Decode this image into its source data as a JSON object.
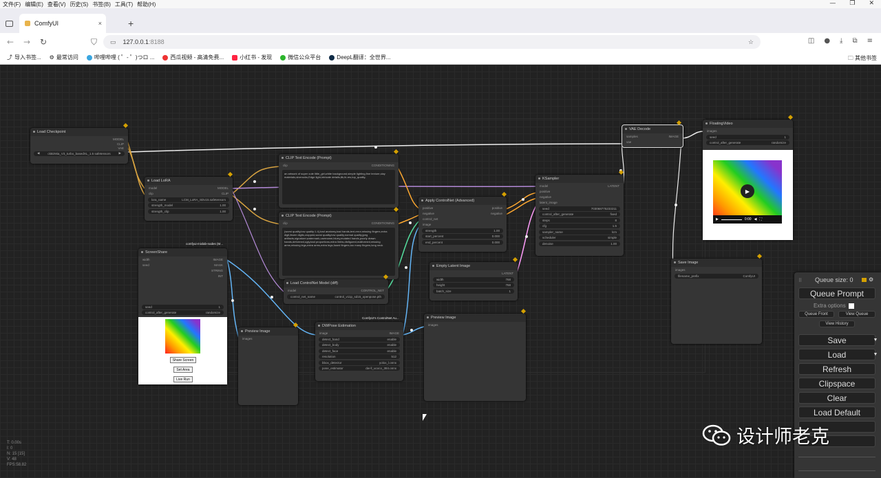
{
  "menubar": {
    "items": [
      "文件(F)",
      "编辑(E)",
      "查看(V)",
      "历史(S)",
      "书签(B)",
      "工具(T)",
      "帮助(H)"
    ]
  },
  "window_controls": {
    "minimize": "—",
    "restore": "❐",
    "close": "✕"
  },
  "tab": {
    "title": "ComfyUI",
    "close": "×",
    "new": "+"
  },
  "address": {
    "host": "127.0.0.1",
    "port": ":8188"
  },
  "bookmarks": {
    "items": [
      "导入书签...",
      "最常访问",
      "哔哩哔哩 ( ゜- ゜)つロ ...",
      "西瓜视频 - 高清免费...",
      "小红书 - 发现",
      "微信公众平台",
      "DeepL翻译：全世界..."
    ],
    "other": "其他书签"
  },
  "nodes": {
    "load_checkpoint": {
      "title": "Load Checkpoint",
      "outputs": [
        "MODEL",
        "CLIP",
        "VAE"
      ],
      "ckpt": "ckBzMia_V3_turbo_basedXL_1.5 safetensors"
    },
    "load_lora": {
      "title": "Load LoRA",
      "inputs": [
        "model",
        "clip"
      ],
      "outputs": [
        "MODEL",
        "CLIP"
      ],
      "widgets": [
        [
          "lora_name",
          "LCM_LoRA_SDv15.safetensors"
        ],
        [
          "strength_model",
          "1.00"
        ],
        [
          "strength_clip",
          "1.00"
        ]
      ]
    },
    "clip_pos": {
      "title": "CLIP Text Encode (Prompt)",
      "input": "clip",
      "output": "CONDITIONING",
      "text": "an artwork of super cute little_girl,white background,simple lighting,fine texture,clay materials,siverocks,Edge light,intricate details,8k,hi-res,top_quality,"
    },
    "clip_neg": {
      "title": "CLIP Text Encode (Prompt)",
      "input": "clip",
      "output": "CONDITIONING",
      "text": "(worst quality,low quality:1.4),bad anatomy,bad hands,text,error,missing fingers,extra digit,fewer digits,cropped,worst quality,low quality,normal quality,jpeg artifacts,signature,watermark,username,blurry,mutated hands,poorly drawn hands,deformed,ugly,bad proportions,extra limbs,disfigured,malformed,missing arms,missing legs,extra arms,extra legs,fused fingers,too many fingers,long neck"
    },
    "apply_controlnet": {
      "title": "Apply ControlNet (Advanced)",
      "inputs": [
        "positive",
        "negative",
        "control_net",
        "image"
      ],
      "outputs": [
        "positive",
        "negative"
      ],
      "widgets": [
        [
          "strength",
          "1.00"
        ],
        [
          "start_percent",
          "0.000"
        ],
        [
          "end_percent",
          "0.000"
        ]
      ]
    },
    "ksampler": {
      "title": "KSampler",
      "inputs": [
        "model",
        "positive",
        "negative",
        "latent_image"
      ],
      "output": "LATENT",
      "widgets": [
        [
          "seed",
          "703068775233211"
        ],
        [
          "control_after_generate",
          "fixed"
        ],
        [
          "steps",
          "8"
        ],
        [
          "cfg",
          "1.5"
        ],
        [
          "sampler_name",
          "lcm"
        ],
        [
          "scheduler",
          "simple"
        ],
        [
          "denoise",
          "1.00"
        ]
      ]
    },
    "vae_decode": {
      "title": "VAE Decode",
      "inputs": [
        "samples",
        "vae"
      ],
      "output": "IMAGE"
    },
    "floating_video": {
      "title": "FloatingVideo",
      "input": "images",
      "widgets": [
        [
          "seed",
          "1"
        ],
        [
          "control_after_generate",
          "randomize"
        ]
      ],
      "time": "0:00"
    },
    "save_image": {
      "title": "Save Image",
      "input": "images",
      "widgets": [
        [
          "filename_prefix",
          "ComfyUI"
        ]
      ]
    },
    "screen_share": {
      "title": "ScreenShare",
      "tag": "comfyui-mixlab-nodes (M...",
      "inputs": [
        "width",
        "seed"
      ],
      "outputs": [
        "IMAGE",
        "MASK",
        "STRING",
        "INT"
      ],
      "widgets": [
        [
          "seed",
          "1"
        ],
        [
          "control_after_generate",
          "randomize"
        ]
      ],
      "buttons": [
        "Share Screen",
        "Set Area",
        "Live Run"
      ]
    },
    "load_controlnet": {
      "title": "Load ControlNet Model (diff)",
      "input": "model",
      "output": "CONTROL_NET",
      "widgets": [
        [
          "control_net_name",
          "control_v11p_sd15_openpose.pth"
        ]
      ]
    },
    "empty_latent": {
      "title": "Empty Latent Image",
      "output": "LATENT",
      "widgets": [
        [
          "width",
          "768"
        ],
        [
          "height",
          "768"
        ],
        [
          "batch_size",
          "1"
        ]
      ]
    },
    "preview_image_1": {
      "title": "Preview Image",
      "input": "images"
    },
    "preview_image_2": {
      "title": "Preview Image",
      "input": "images"
    },
    "dwpose": {
      "title": "DWPose Estimation",
      "tag": "ComfyUI's ControlNet Au...",
      "input": "image",
      "output": "IMAGE",
      "widgets": [
        [
          "detect_hand",
          "enable"
        ],
        [
          "detect_body",
          "enable"
        ],
        [
          "detect_face",
          "enable"
        ],
        [
          "resolution",
          "512"
        ],
        [
          "bbox_detector",
          "yolox_l.onnx"
        ],
        [
          "pose_estimator",
          "dw-ll_ucoco_384.onnx"
        ]
      ]
    }
  },
  "queue_panel": {
    "queue_size": "Queue size: 0",
    "queue_prompt": "Queue Prompt",
    "extra_options": "Extra options",
    "queue_front": "Queue Front",
    "view_queue": "View Queue",
    "view_history": "View History",
    "save": "Save",
    "load": "Load",
    "refresh": "Refresh",
    "clipspace": "Clipspace",
    "clear": "Clear",
    "load_default": "Load Default"
  },
  "stats": [
    "T: 0.00s",
    "I: 0",
    "N: 15 [15]",
    "V: 48",
    "FPS:58.82"
  ],
  "watermark": "设计师老克"
}
